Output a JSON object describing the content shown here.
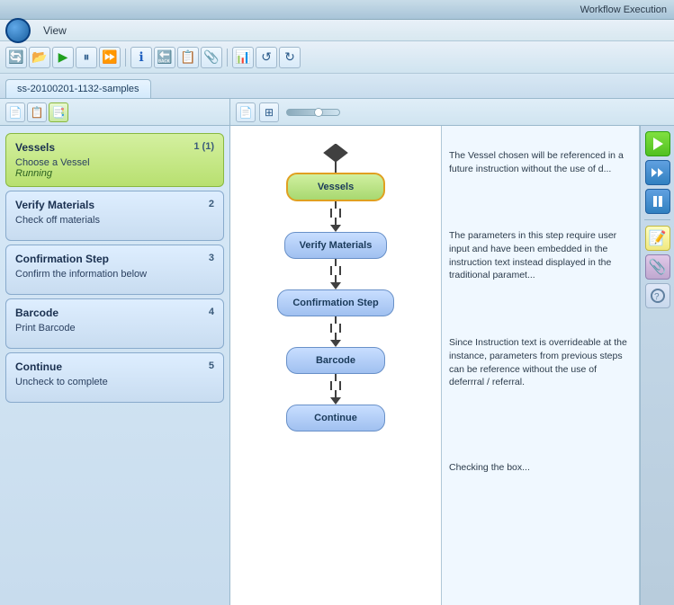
{
  "titleBar": {
    "title": "Workflow Execution"
  },
  "menuBar": {
    "items": [
      "View"
    ]
  },
  "toolbar": {
    "buttons": [
      {
        "name": "refresh-icon",
        "icon": "🔄"
      },
      {
        "name": "folder-icon",
        "icon": "📂"
      },
      {
        "name": "play-icon",
        "icon": "▶"
      },
      {
        "name": "pause-icon",
        "icon": "⏸"
      },
      {
        "name": "forward-icon",
        "icon": "⏩"
      },
      {
        "name": "info-icon",
        "icon": "ℹ"
      },
      {
        "name": "back-icon",
        "icon": "◀"
      },
      {
        "name": "notes-icon",
        "icon": "📋"
      },
      {
        "name": "clip-icon",
        "icon": "📎"
      },
      {
        "name": "chart-icon",
        "icon": "📊"
      },
      {
        "name": "reset-icon",
        "icon": "↺"
      },
      {
        "name": "reload-icon",
        "icon": "↻"
      }
    ]
  },
  "tabBar": {
    "activeTab": "ss-20100201-1132-samples"
  },
  "leftPanel": {
    "panelButtons": [
      "doc-icon",
      "list-icon",
      "grid-icon"
    ],
    "workflowItems": [
      {
        "id": 1,
        "title": "Vessels",
        "number": "1 (1)",
        "subtitle": "Choose a Vessel",
        "status": "Running",
        "state": "active"
      },
      {
        "id": 2,
        "title": "Verify Materials",
        "number": "2",
        "subtitle": "Check off materials",
        "status": "",
        "state": "inactive"
      },
      {
        "id": 3,
        "title": "Confirmation Step",
        "number": "3",
        "subtitle": "Confirm the information below",
        "status": "",
        "state": "inactive"
      },
      {
        "id": 4,
        "title": "Barcode",
        "number": "4",
        "subtitle": "Print Barcode",
        "status": "",
        "state": "inactive"
      },
      {
        "id": 5,
        "title": "Continue",
        "number": "5",
        "subtitle": "Uncheck to complete",
        "status": "",
        "state": "inactive"
      }
    ]
  },
  "diagram": {
    "nodes": [
      {
        "id": "vessels",
        "label": "Vessels",
        "type": "green-yellow"
      },
      {
        "id": "verify-materials",
        "label": "Verify Materials",
        "type": "blue"
      },
      {
        "id": "confirmation-step",
        "label": "Confirmation Step",
        "type": "blue"
      },
      {
        "id": "barcode",
        "label": "Barcode",
        "type": "blue"
      },
      {
        "id": "continue",
        "label": "Continue",
        "type": "blue"
      }
    ],
    "descriptions": [
      {
        "nodeId": "vessels",
        "text": "The Vessel chosen will be referenced in a future instruction without the use of d..."
      },
      {
        "nodeId": "verify-materials",
        "text": "The parameters in this step require user input and have been embedded in the instruction text instead displayed in the traditional paramet..."
      },
      {
        "nodeId": "confirmation-step",
        "text": "Since Instruction text is overrideable at the instance, parameters from previous steps can be reference without the use of deferrral / referral."
      },
      {
        "nodeId": "continue",
        "text": "Checking the box..."
      }
    ]
  },
  "sideToolbar": {
    "buttons": [
      {
        "name": "play-large-icon",
        "icon": "▶",
        "type": "green"
      },
      {
        "name": "fast-forward-icon",
        "icon": "⏭",
        "type": "blue"
      },
      {
        "name": "pause-large-icon",
        "type": "pause"
      },
      {
        "name": "note-icon",
        "icon": "📝",
        "type": "note"
      },
      {
        "name": "attachment-icon",
        "icon": "📎",
        "type": "clip"
      }
    ]
  }
}
